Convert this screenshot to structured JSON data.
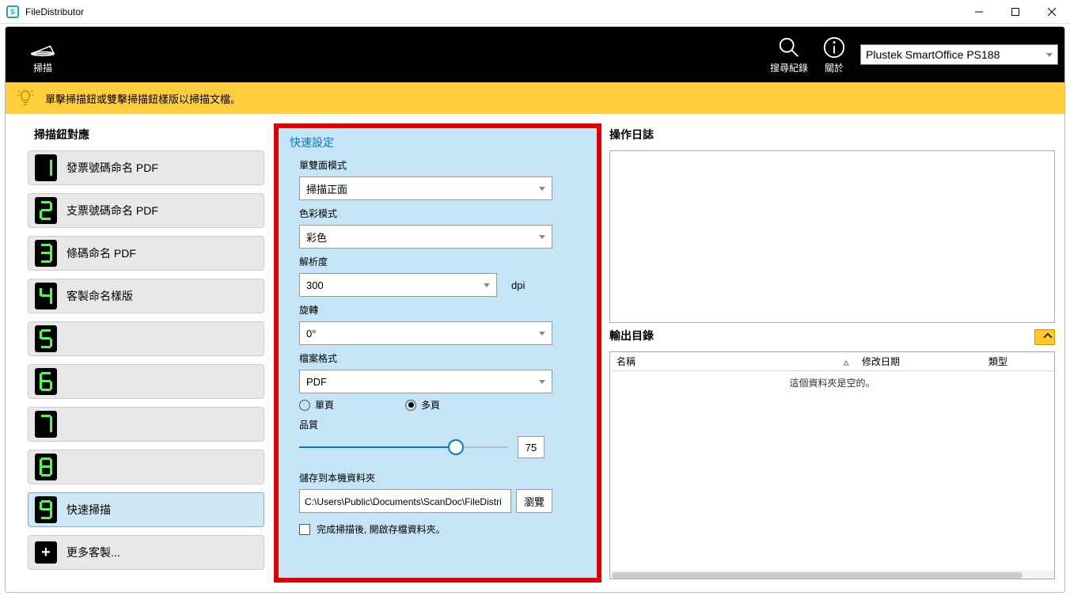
{
  "app": {
    "title": "FileDistributor"
  },
  "topbar": {
    "scan_label": "掃描",
    "search_label": "搜尋紀錄",
    "about_label": "關於",
    "scanner_selected": "Plustek SmartOffice PS188"
  },
  "hint": {
    "text": "單擊掃描鈕或雙擊掃描鈕樣版以掃描文檔。"
  },
  "sidebar": {
    "title": "掃描鈕對應",
    "presets": [
      {
        "digit": "1",
        "label": "發票號碼命名 PDF"
      },
      {
        "digit": "2",
        "label": "支票號碼命名 PDF"
      },
      {
        "digit": "3",
        "label": "條碼命名 PDF"
      },
      {
        "digit": "4",
        "label": "客製命名樣版"
      },
      {
        "digit": "5",
        "label": ""
      },
      {
        "digit": "6",
        "label": ""
      },
      {
        "digit": "7",
        "label": ""
      },
      {
        "digit": "8",
        "label": ""
      },
      {
        "digit": "9",
        "label": "快速掃描"
      }
    ],
    "more_label": "更多客製..."
  },
  "settings": {
    "panel_title": "快速設定",
    "duplex_label": "單雙面模式",
    "duplex_value": "掃描正面",
    "color_label": "色彩模式",
    "color_value": "彩色",
    "resolution_label": "解析度",
    "resolution_value": "300",
    "resolution_unit": "dpi",
    "rotate_label": "旋轉",
    "rotate_value": "0°",
    "format_label": "檔案格式",
    "format_value": "PDF",
    "page_single": "單頁",
    "page_multi": "多頁",
    "page_selected": "multi",
    "quality_label": "品質",
    "quality_value": "75",
    "save_label": "儲存到本機資料夾",
    "save_path": "C:\\Users\\Public\\Documents\\ScanDoc\\FileDistri",
    "browse_label": "瀏覽",
    "open_after_label": "完成掃描後, 開啟存檔資料夾。"
  },
  "log": {
    "title": "操作日誌"
  },
  "outdir": {
    "title": "輸出目錄",
    "col_name": "名稱",
    "col_date": "修改日期",
    "col_type": "類型",
    "empty_text": "這個資料夾是空的。"
  }
}
